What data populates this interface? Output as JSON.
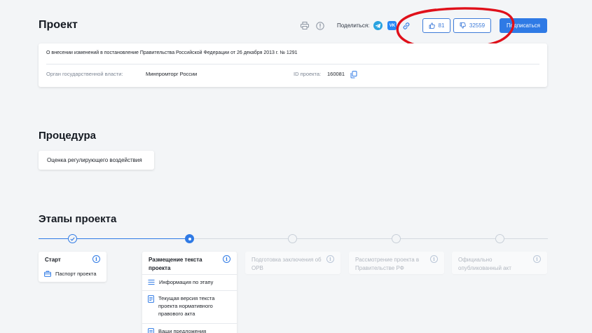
{
  "header": {
    "title": "Проект",
    "share_label": "Поделиться:",
    "likes": "81",
    "dislikes": "32559",
    "subscribe_label": "Подписаться"
  },
  "project": {
    "description": "О внесении изменений в постановление Правительства Российской Федерации от 26 декабря 2013 г. № 1291",
    "authority_label": "Орган государственной власти:",
    "authority_value": "Минпромторг России",
    "id_label": "ID проекта:",
    "id_value": "160081"
  },
  "procedure": {
    "title": "Процедура",
    "item": "Оценка регулирующего воздействия"
  },
  "stages": {
    "title": "Этапы проекта",
    "items": [
      {
        "title": "Старт",
        "sub": [
          "Паспорт проекта"
        ]
      },
      {
        "title": "Размещение текста проекта",
        "sub": [
          "Информация по этапу",
          "Текущая версия текста проекта нормативного правового акта",
          "Ваши предложения"
        ]
      },
      {
        "title": "Подготовка заключения об ОРВ"
      },
      {
        "title": "Рассмотрение проекта в Правительстве РФ"
      },
      {
        "title": "Официально опубликованный акт"
      }
    ]
  },
  "colors": {
    "accent": "#2f7ae5",
    "annotation": "#e0101a"
  },
  "icons": [
    "print-icon",
    "info-icon",
    "telegram-icon",
    "vk-icon",
    "link-icon",
    "thumbs-up-icon",
    "thumbs-down-icon",
    "copy-icon",
    "check-icon",
    "briefcase-icon",
    "list-icon",
    "document-icon"
  ]
}
